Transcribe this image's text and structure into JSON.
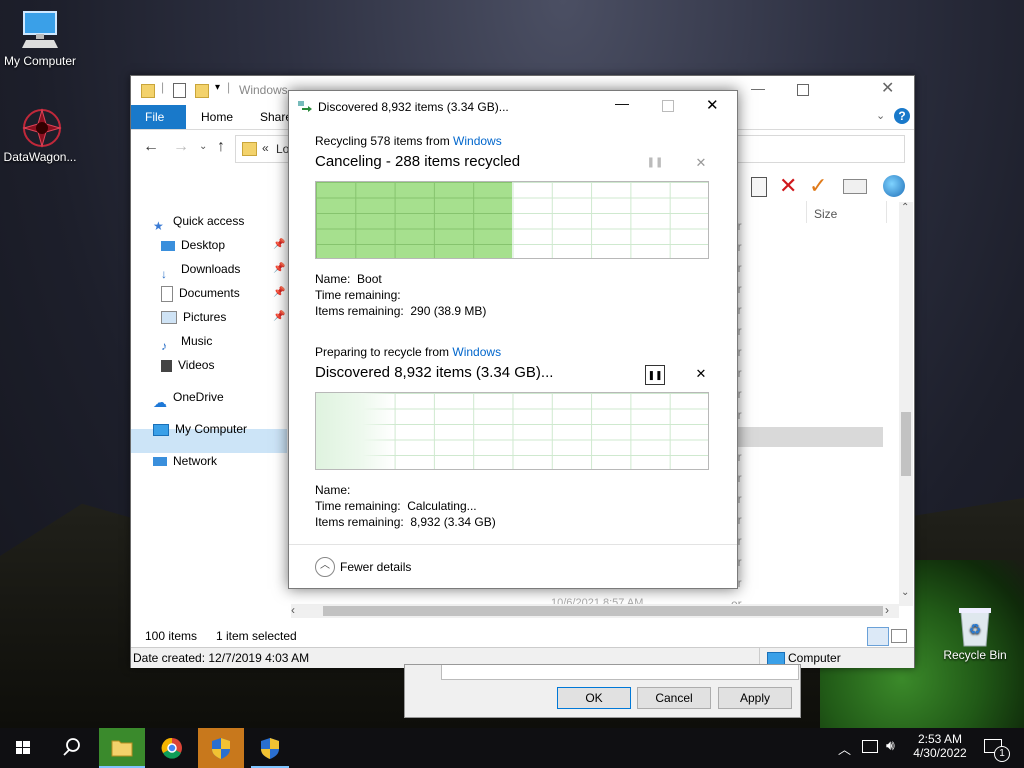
{
  "desktop": {
    "icons": [
      {
        "label": "My Computer"
      },
      {
        "label": "DataWagon..."
      },
      {
        "label": "Recycle Bin"
      }
    ]
  },
  "explorer": {
    "title": "Windows",
    "tabs": [
      "File",
      "Home",
      "Share"
    ],
    "address": "Lo",
    "columns": {
      "size": "Size"
    },
    "nav": {
      "quick_access": "Quick access",
      "desktop": "Desktop",
      "downloads": "Downloads",
      "documents": "Documents",
      "pictures": "Pictures",
      "music": "Music",
      "videos": "Videos",
      "onedrive": "OneDrive",
      "my_computer": "My Computer",
      "network": "Network"
    },
    "partial_row": "10/6/2021 8:57 AM",
    "status": {
      "items": "100 items",
      "selected": "1 item selected"
    },
    "bottom": {
      "created": "Date created: 12/7/2019 4:03 AM",
      "location": "Computer"
    }
  },
  "props_dialog": {
    "ok": "OK",
    "cancel": "Cancel",
    "apply": "Apply"
  },
  "copy_dialog": {
    "title": "Discovered 8,932 items (3.34 GB)...",
    "op1": {
      "prefix": "Recycling 578 items from ",
      "source": "Windows",
      "headline": "Canceling - 288 items recycled",
      "progress": 0.5,
      "name_label": "Name:",
      "name_value": "Boot",
      "time_label": "Time remaining:",
      "time_value": "",
      "items_label": "Items remaining:",
      "items_value": "290 (38.9 MB)"
    },
    "op2": {
      "prefix": "Preparing to recycle from ",
      "source": "Windows",
      "headline": "Discovered 8,932 items (3.34 GB)...",
      "progress": 0.2,
      "name_label": "Name:",
      "name_value": "",
      "time_label": "Time remaining:",
      "time_value": "Calculating...",
      "items_label": "Items remaining:",
      "items_value": "8,932 (3.34 GB)"
    },
    "fewer_details": "Fewer details"
  },
  "taskbar": {
    "time": "2:53 AM",
    "date": "4/30/2022",
    "notification_count": "1"
  },
  "colors": {
    "accent": "#1979ca",
    "progress_green": "#a6e08e"
  }
}
